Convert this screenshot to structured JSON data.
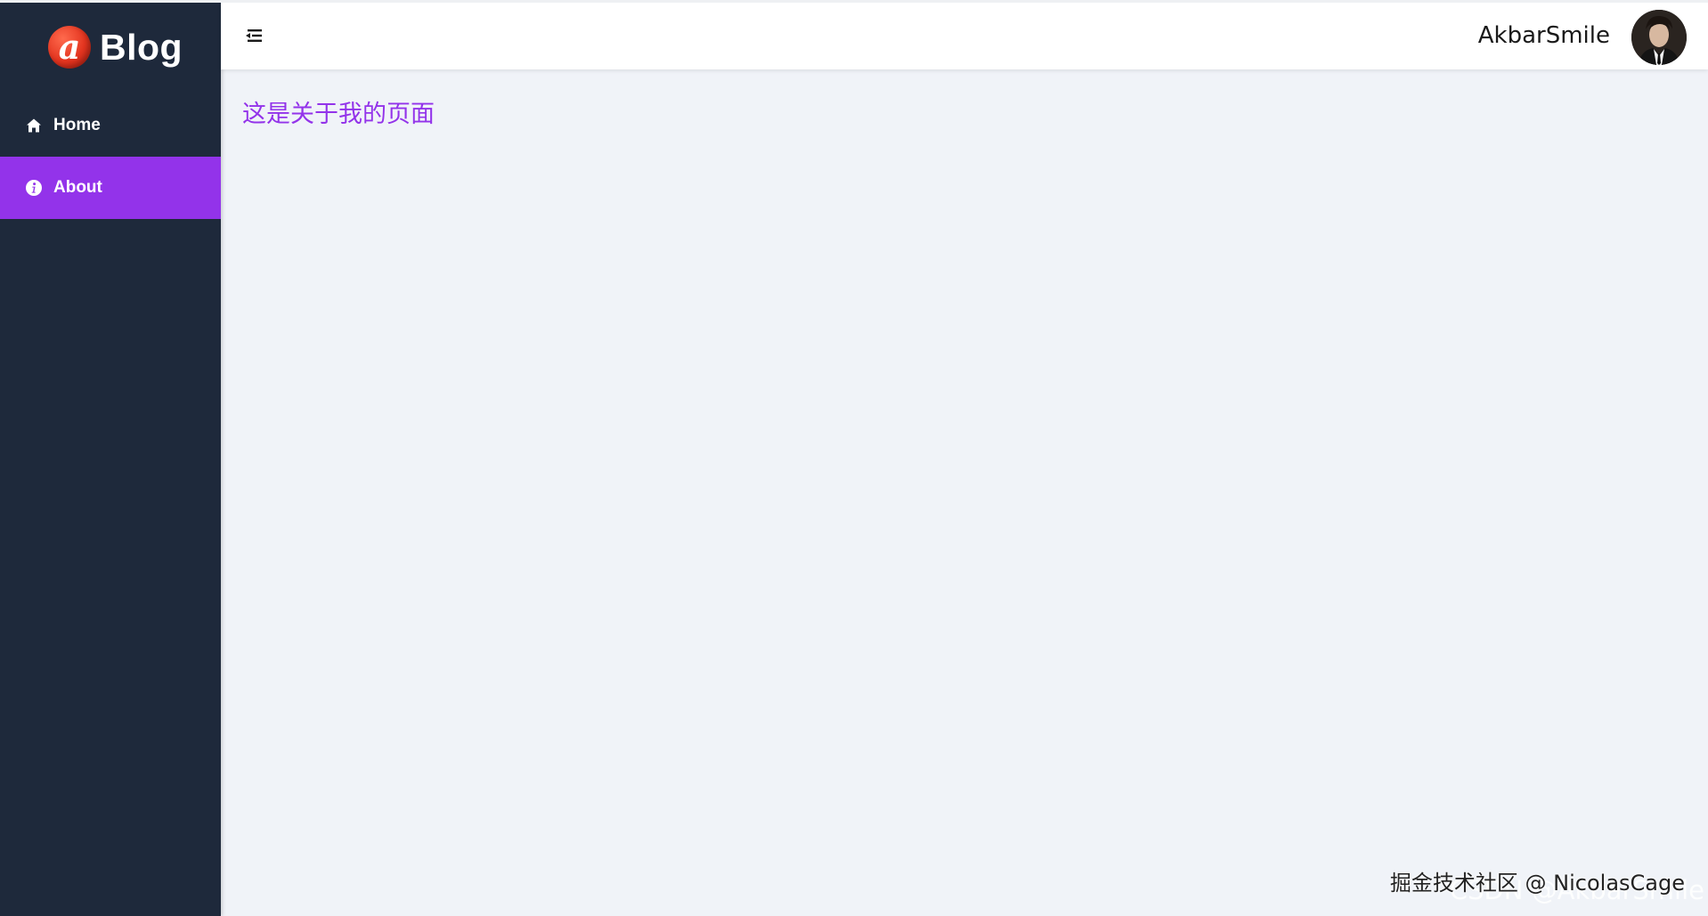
{
  "sidebar": {
    "brand": {
      "logo_glyph": "a",
      "title": "Blog",
      "logo_color": "#e3341f"
    },
    "items": [
      {
        "label": "Home",
        "icon": "home-icon",
        "active": false
      },
      {
        "label": "About",
        "icon": "info-icon",
        "active": true
      }
    ],
    "background": "#1e293b",
    "active_color": "#9333ea"
  },
  "header": {
    "menu_toggle_icon": "menu-fold-icon",
    "username": "AkbarSmile",
    "avatar_icon": "user-avatar"
  },
  "main": {
    "page_text": "这是关于我的页面",
    "text_color": "#9333ea",
    "background": "#f0f3f8"
  },
  "watermarks": {
    "primary": "掘金技术社区 @ NicolasCage",
    "secondary": "CSDN @AkbarSmile"
  }
}
